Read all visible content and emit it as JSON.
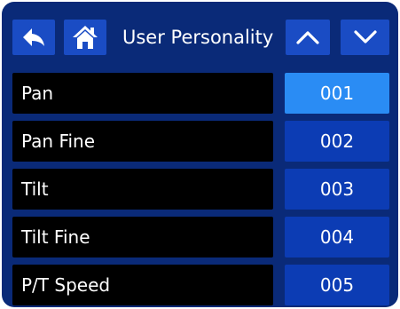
{
  "header": {
    "title": "User Personality",
    "back_icon": "back-arrow-icon",
    "home_icon": "home-icon",
    "up_icon": "chevron-up-icon",
    "down_icon": "chevron-down-icon"
  },
  "rows": [
    {
      "label": "Pan",
      "value": "001",
      "selected": true
    },
    {
      "label": "Pan Fine",
      "value": "002",
      "selected": false
    },
    {
      "label": "Tilt",
      "value": "003",
      "selected": false
    },
    {
      "label": "Tilt Fine",
      "value": "004",
      "selected": false
    },
    {
      "label": "P/T Speed",
      "value": "005",
      "selected": false
    }
  ],
  "colors": {
    "panel_background": "#0a2a78",
    "button": "#1a4cc4",
    "value_cell": "#0c3cb4",
    "value_cell_selected": "#2a8cf4",
    "label_cell": "#000000",
    "text": "#ffffff"
  }
}
